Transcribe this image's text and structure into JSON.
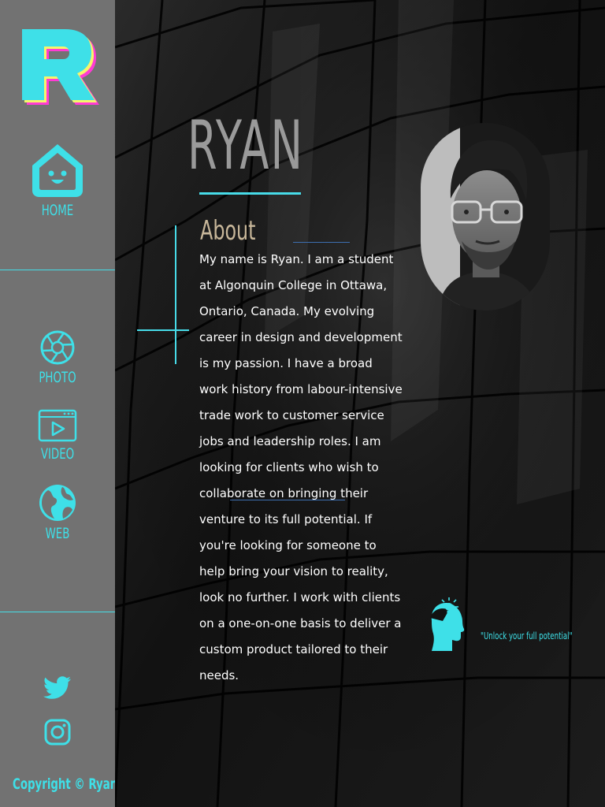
{
  "brand": {
    "logo_letter": "R"
  },
  "nav": {
    "home": {
      "label": "HOME",
      "icon": "house-face-icon"
    },
    "photo": {
      "label": "PHOTO",
      "icon": "camera-aperture-icon"
    },
    "video": {
      "label": "VIDEO",
      "icon": "video-player-icon"
    },
    "web": {
      "label": "WEB",
      "icon": "globe-icon"
    }
  },
  "social": [
    {
      "name": "Twitter",
      "icon": "twitter-icon"
    },
    {
      "name": "Instagram",
      "icon": "instagram-icon"
    }
  ],
  "footer": {
    "copyright": "Copyright © Ryan"
  },
  "hero": {
    "name": "RYAN"
  },
  "about": {
    "title": "About",
    "text": "My name is Ryan. I am a student at Algonquin College in Ottawa, Ontario, Canada. My evolving career in design and development is my passion. I have a broad work history from labour-intensive trade work to customer service jobs and leadership roles. I am looking for clients who wish to collaborate on bringing their venture to its full potential. If you're looking for someone to help bring your vision to reality, look no further. I work with clients on a one-on-one basis to deliver a custom product tailored to their needs."
  },
  "quote": {
    "text": "\"Unlock your full potential\"",
    "icon": "head-lightbulb-icon"
  },
  "colors": {
    "accent": "#3ee0e8",
    "sidebar": "#727272",
    "background": "#0c0c0c",
    "name_text": "#9a9a9a",
    "about_title": "#c8b79a",
    "logo_magenta": "#ff3bd4",
    "logo_yellow": "#f7f56a"
  }
}
